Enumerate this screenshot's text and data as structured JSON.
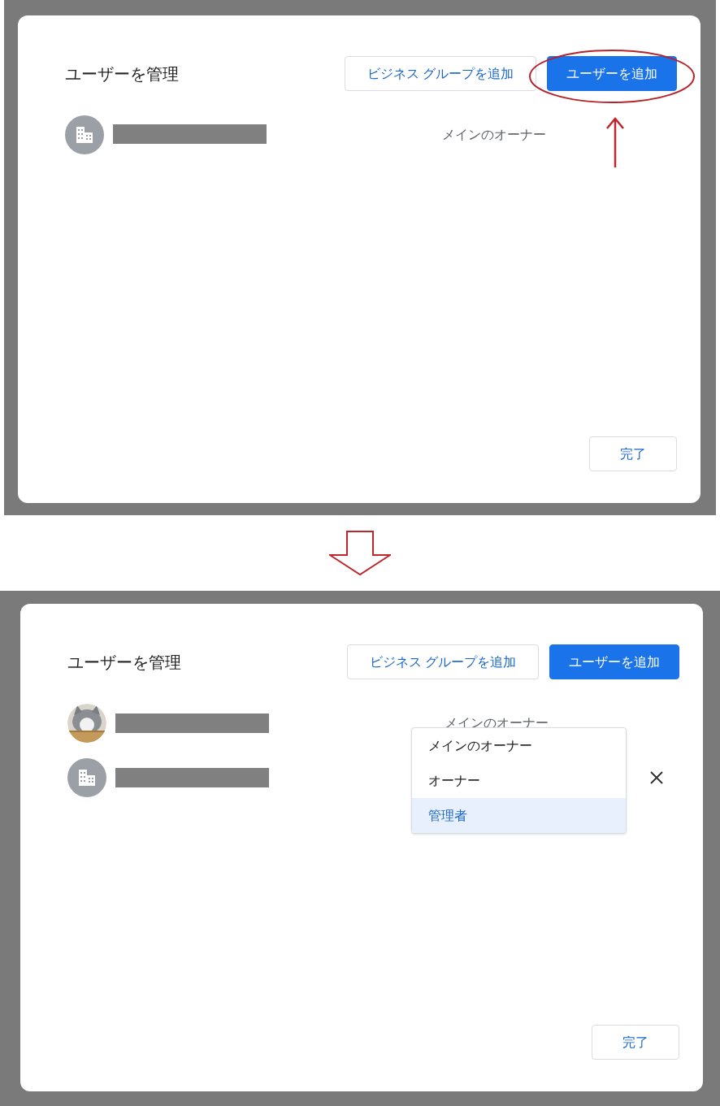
{
  "steps": [
    {
      "dialog": {
        "title": "ユーザーを管理",
        "buttons": [
          {
            "label": "ビジネス グループを追加",
            "kind": "outlined",
            "circled": false
          },
          {
            "label": "ユーザーを追加",
            "kind": "filled",
            "circled": true
          }
        ],
        "users": [
          {
            "kind": "building",
            "role": "メインのオーナー"
          }
        ],
        "done_button": "完了"
      }
    },
    {
      "dialog": {
        "title": "ユーザーを管理",
        "buttons": [
          {
            "label": "ビジネス グループを追加",
            "kind": "outlined",
            "circled": false
          },
          {
            "label": "ユーザーを追加",
            "kind": "filled",
            "circled": false
          }
        ],
        "users": [
          {
            "kind": "picture",
            "role": "メインのオーナー"
          },
          {
            "kind": "building"
          }
        ],
        "role_menu": {
          "options": [
            {
              "label": "メインのオーナー",
              "selected": false
            },
            {
              "label": "オーナー",
              "selected": false
            },
            {
              "label": "管理者",
              "selected": true
            }
          ]
        },
        "done_button": "完了"
      }
    }
  ]
}
